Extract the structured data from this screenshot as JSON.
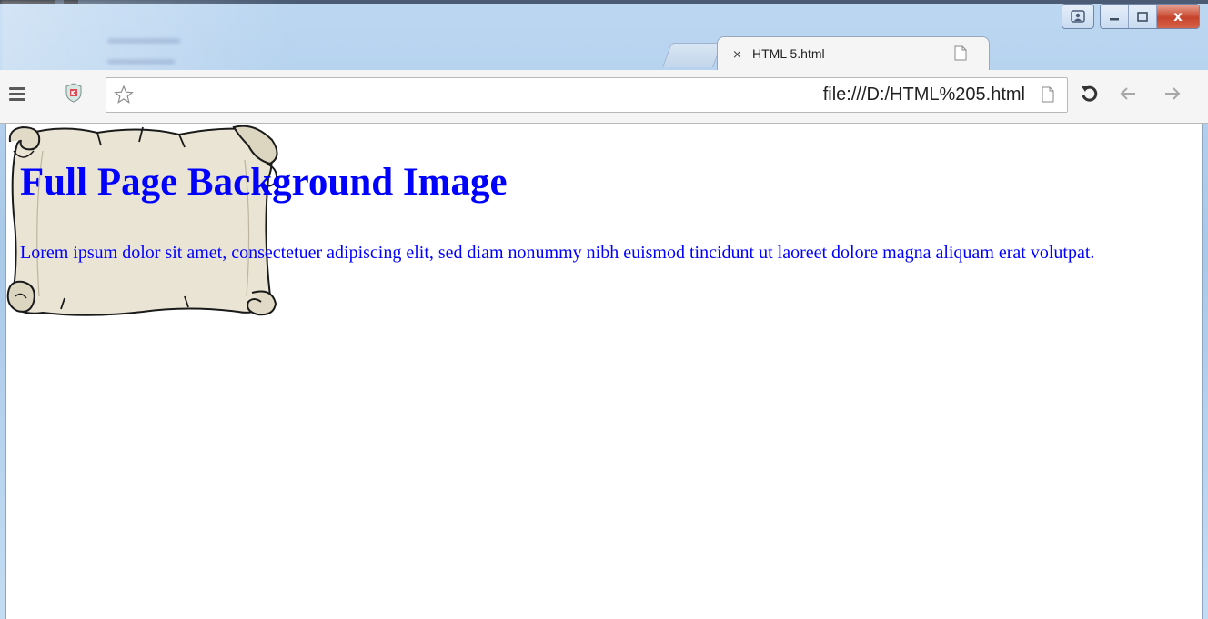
{
  "window": {
    "caption_close": "x"
  },
  "tabs": [
    {
      "label": "HTML 5.html",
      "close_symbol": "×",
      "active": true
    }
  ],
  "toolbar": {
    "address": "file:///D:/HTML%205.html"
  },
  "page": {
    "heading": "Full Page Background Image",
    "paragraph": "Lorem ipsum dolor sit amet, consectetuer adipiscing elit, sed diam nonummy nibh euismod tincidunt ut laoreet dolore magna aliquam erat volutpat."
  },
  "colors": {
    "page_text": "#0000ff",
    "scroll_fill": "#e9e4d3",
    "close_button": "#c7432b"
  },
  "icons": [
    "menu-icon",
    "extension-shield-icon",
    "star-icon",
    "page-icon",
    "reload-icon",
    "back-arrow-icon",
    "forward-arrow-icon",
    "user-icon",
    "minimize-icon",
    "maximize-icon",
    "close-icon",
    "file-icon",
    "scroll-image"
  ]
}
